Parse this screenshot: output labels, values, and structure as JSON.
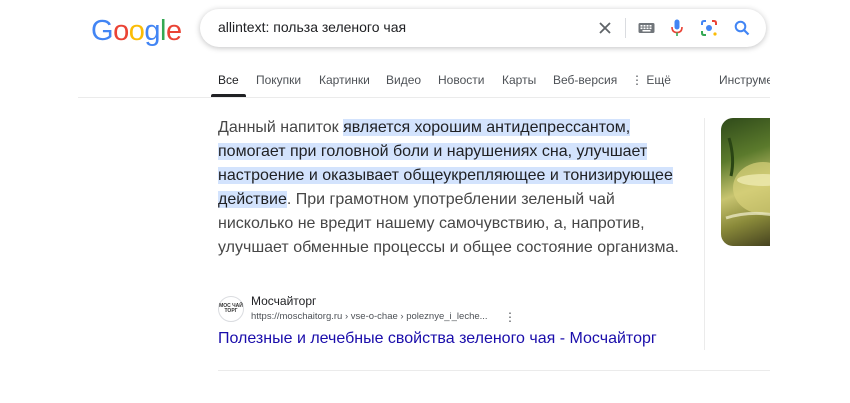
{
  "logo": {
    "letters": [
      "G",
      "o",
      "o",
      "g",
      "l",
      "e"
    ],
    "colors": [
      "#4285f4",
      "#ea4335",
      "#fbbc05",
      "#4285f4",
      "#34a853",
      "#ea4335"
    ]
  },
  "search": {
    "query": "allintext: польза зеленого чая",
    "icons": [
      "close-icon",
      "keyboard-icon",
      "microphone-icon",
      "lens-icon",
      "search-icon"
    ]
  },
  "tabs": [
    {
      "label": "Все",
      "active": true
    },
    {
      "label": "Покупки"
    },
    {
      "label": "Картинки"
    },
    {
      "label": "Видео"
    },
    {
      "label": "Новости"
    },
    {
      "label": "Карты"
    },
    {
      "label": "Веб-версия"
    },
    {
      "label": "⋮ Ещё"
    },
    {
      "label": "Инструме"
    }
  ],
  "snippet": {
    "before": "Данный напиток ",
    "highlight": "является хорошим антидепрессантом, помогает при головной боли и нарушениях сна, улучшает настроение и оказывает общеукрепляющее и тонизирующее действие",
    "after": ". При грамотном употреблении зеленый чай нисколько не вредит нашему самочувствию, а, напротив, улучшает обменные процессы и общее состояние организма."
  },
  "source": {
    "favicon_text": "МОС ЧАЙ ТОРГ",
    "name": "Мосчайторг",
    "url": "https://moschaitorg.ru › vse-o-chae › poleznye_i_leche..."
  },
  "result": {
    "title": "Полезные и лечебные свойства зеленого чая - Мосчайторг"
  },
  "colors": {
    "link": "#1a0dab",
    "highlight": "#d3e3fd"
  }
}
